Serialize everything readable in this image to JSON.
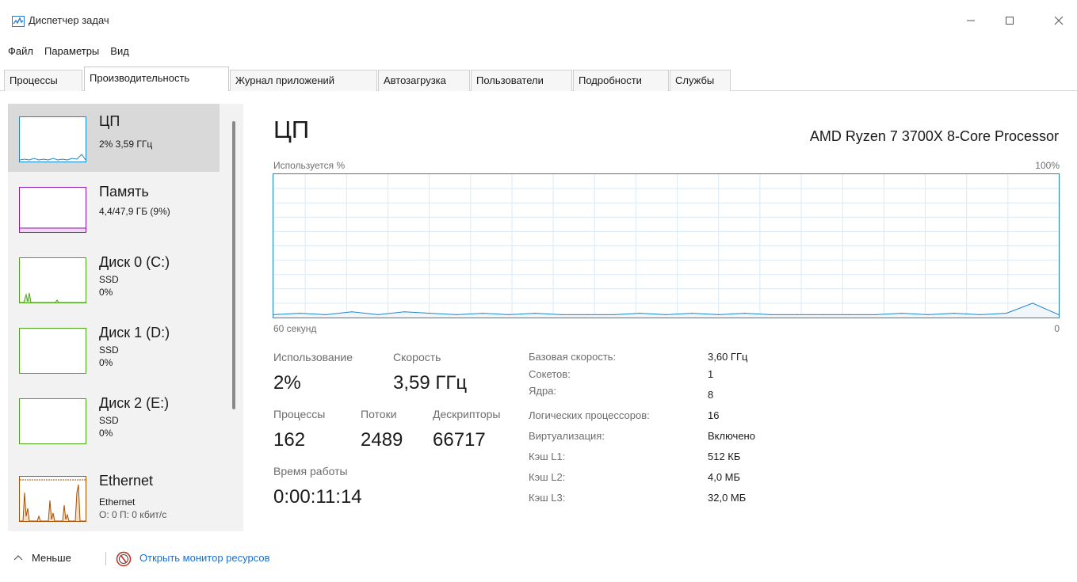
{
  "window": {
    "title": "Диспетчер задач",
    "app_icon": "task-manager-icon",
    "controls": [
      "minimize-icon",
      "maximize-icon",
      "close-icon"
    ]
  },
  "menu": [
    "Файл",
    "Параметры",
    "Вид"
  ],
  "tabs": [
    "Процессы",
    "Производительность",
    "Журнал приложений",
    "Автозагрузка",
    "Пользователи",
    "Подробности",
    "Службы"
  ],
  "active_tab": "Производительность",
  "sidebar": {
    "items": [
      {
        "title": "ЦП",
        "line1": "2% 3,59 ГГц",
        "line2": "",
        "color": "#1a86cf",
        "selected": true
      },
      {
        "title": "Память",
        "line1": "4,4/47,9 ГБ (9%)",
        "line2": "",
        "color": "#8b19b1",
        "selected": false
      },
      {
        "title": "Диск 0 (C:)",
        "line1": "SSD",
        "line2": "0%",
        "color": "#4da618",
        "selected": false
      },
      {
        "title": "Диск 1 (D:)",
        "line1": "SSD",
        "line2": "0%",
        "color": "#4da618",
        "selected": false
      },
      {
        "title": "Диск 2 (E:)",
        "line1": "SSD",
        "line2": "0%",
        "color": "#4da618",
        "selected": false
      },
      {
        "title": "Ethernet",
        "line1": "Ethernet",
        "line2": "О: 0 П: 0 кбит/с",
        "color": "#a74f01",
        "selected": false
      }
    ]
  },
  "main": {
    "title": "ЦП",
    "processor": "AMD Ryzen 7 3700X 8-Core Processor",
    "graph_label_top_left": "Используется %",
    "graph_label_top_right": "100%",
    "graph_label_bottom_left": "60 секунд",
    "graph_label_bottom_right": "0",
    "stats": {
      "usage_label": "Использование",
      "usage_value": "2%",
      "speed_label": "Скорость",
      "speed_value": "3,59 ГГц",
      "processes_label": "Процессы",
      "processes_value": "162",
      "threads_label": "Потоки",
      "threads_value": "2489",
      "handles_label": "Дескрипторы",
      "handles_value": "66717",
      "uptime_label": "Время работы",
      "uptime_value": "0:00:11:14"
    },
    "info": [
      {
        "label": "Базовая скорость:",
        "value": "3,60 ГГц"
      },
      {
        "label": "Сокетов:",
        "value": "1"
      },
      {
        "label": "Ядра:",
        "value": "8"
      },
      {
        "label": "Логических процессоров:",
        "value": "16"
      },
      {
        "label": "Виртуализация:",
        "value": "Включено"
      },
      {
        "label": "Кэш L1:",
        "value": "512 КБ"
      },
      {
        "label": "Кэш L2:",
        "value": "4,0 МБ"
      },
      {
        "label": "Кэш L3:",
        "value": "32,0 МБ"
      }
    ]
  },
  "footer": {
    "less_label": "Меньше",
    "monitor_link": "Открыть монитор ресурсов"
  },
  "chart_data": {
    "type": "area",
    "x": [
      60,
      58,
      56,
      54,
      52,
      50,
      48,
      46,
      44,
      42,
      40,
      38,
      36,
      34,
      32,
      30,
      28,
      26,
      24,
      22,
      20,
      18,
      16,
      14,
      12,
      10,
      8,
      6,
      4,
      2,
      0
    ],
    "values": [
      2,
      3,
      2,
      4,
      2,
      4,
      3,
      2,
      3,
      2,
      3,
      2,
      2,
      2,
      3,
      2,
      3,
      2,
      3,
      2,
      2,
      2,
      2,
      2,
      3,
      2,
      3,
      2,
      3,
      10,
      2
    ],
    "ylim": [
      0,
      100
    ],
    "xlabel": "60 секунд",
    "ylabel": "Используется %",
    "grid": true,
    "color": "#1a86cf"
  }
}
